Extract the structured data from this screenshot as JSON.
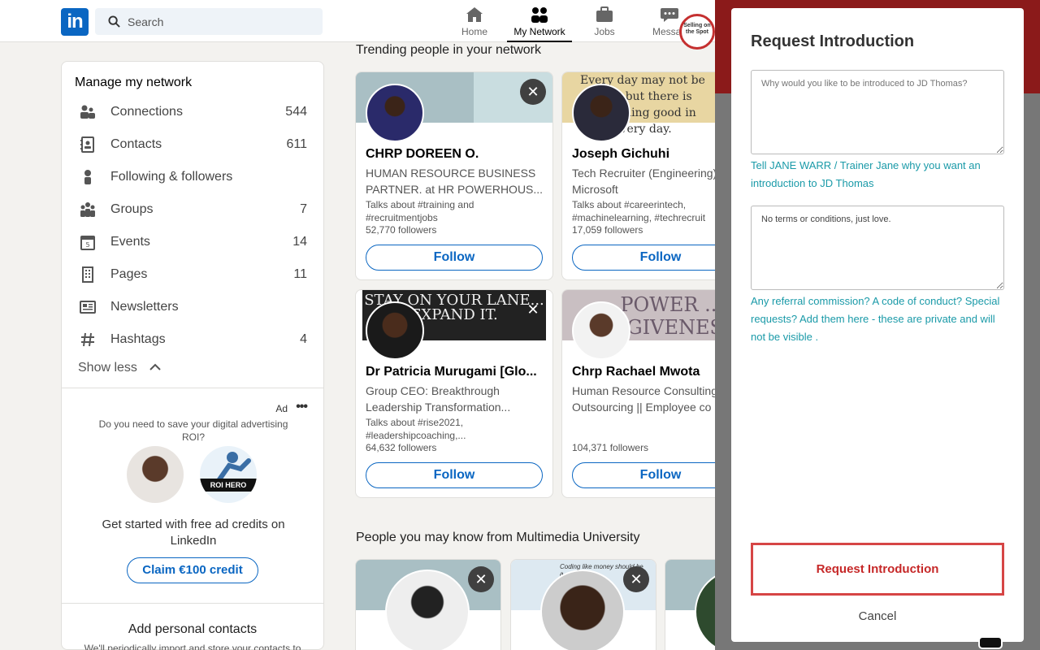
{
  "nav": {
    "logo": "in",
    "search_placeholder": "Search",
    "items": [
      {
        "label": "Home",
        "icon": "home-icon"
      },
      {
        "label": "My Network",
        "icon": "network-icon",
        "active": true
      },
      {
        "label": "Jobs",
        "icon": "jobs-icon"
      },
      {
        "label": "Messag",
        "icon": "messaging-icon"
      }
    ],
    "promo_badge": "Selling on the Spot"
  },
  "sidebar": {
    "title": "Manage my network",
    "items": [
      {
        "label": "Connections",
        "count": "544",
        "icon": "connections-icon"
      },
      {
        "label": "Contacts",
        "count": "611",
        "icon": "contacts-icon"
      },
      {
        "label": "Following & followers",
        "count": "",
        "icon": "person-icon"
      },
      {
        "label": "Groups",
        "count": "7",
        "icon": "groups-icon"
      },
      {
        "label": "Events",
        "count": "14",
        "icon": "calendar-icon"
      },
      {
        "label": "Pages",
        "count": "11",
        "icon": "building-icon"
      },
      {
        "label": "Newsletters",
        "count": "",
        "icon": "newspaper-icon"
      },
      {
        "label": "Hashtags",
        "count": "4",
        "icon": "hashtag-icon"
      }
    ],
    "show_less": "Show less",
    "ad": {
      "label": "Ad",
      "question": "Do you need to save your digital advertising ROI?",
      "brand_ribbon": "ROI HERO",
      "message": "Get started with free ad credits on LinkedIn",
      "cta": "Claim €100 credit"
    },
    "add_contacts": {
      "title": "Add personal contacts",
      "subtitle": "We'll periodically import and store your contacts to"
    }
  },
  "trending": {
    "title": "Trending people in your network",
    "people": [
      {
        "name": "CHRP DOREEN O.",
        "headline": "HUMAN RESOURCE BUSINESS PARTNER. at HR POWERHOUS...",
        "talks": "Talks about #training and #recruitmentjobs",
        "followers": "52,770 followers",
        "follow": "Follow"
      },
      {
        "name": "Joseph Gichuhi",
        "headline": "Tech Recruiter (Engineering) Microsoft",
        "talks": "Talks about #careerintech, #machinelearning, #techrecruit",
        "followers": "17,059 followers",
        "follow": "Follow",
        "banner_text": "Every day may not be good but there is something good in every day."
      },
      {
        "name": "Dr Patricia Murugami [Glo...",
        "headline": "Group CEO: Breakthrough Leadership Transformation...",
        "talks": "Talks about #rise2021, #leadershipcoaching,...",
        "followers": "64,632 followers",
        "follow": "Follow",
        "banner_text": "STAY ON YOUR LANE... EXPAND IT."
      },
      {
        "name": "Chrp Rachael Mwota",
        "headline": "Human Resource Consulting Outsourcing || Employee co",
        "talks": "",
        "followers": "104,371 followers",
        "follow": "Follow",
        "banner_text": "POWER ... RGIVENES"
      }
    ]
  },
  "university": {
    "title": "People you may know from Multimedia University",
    "banner_text_2": "Coding like money should be a..."
  },
  "modal": {
    "title": "Request Introduction",
    "reason_placeholder": "Why would you like to be introduced to JD Thomas?",
    "reason_hint": "Tell JANE WARR / Trainer Jane why you want an introduction to JD Thomas",
    "terms_value": "No terms or conditions, just love.",
    "terms_hint": "Any referral commission? A code of conduct? Special requests? Add them here - these are private and will not be visible .",
    "submit": "Request Introduction",
    "cancel": "Cancel"
  },
  "colors": {
    "brand": "#0a66c2",
    "hint": "#1a9aa8",
    "submit_border": "#d64545"
  }
}
